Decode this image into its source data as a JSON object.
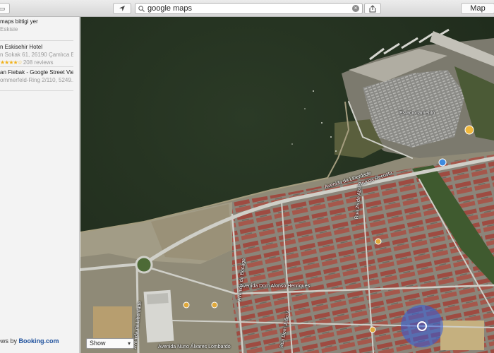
{
  "toolbar": {
    "search_value": "google maps",
    "map_button": "Map"
  },
  "sidebar": {
    "results": [
      {
        "title": "maps bittigi yer",
        "subtitle": "Eskisie"
      },
      {
        "title": "n Eskisehir Hotel",
        "subtitle": "n Sokak 61, 26190 Çamlıca E...",
        "reviews": "208 reviews",
        "stars": 4
      },
      {
        "title": "an Fiebak - Google Street Vie...",
        "subtitle": "ommerfeld-Ring 2/110, 5249..."
      }
    ],
    "attribution_prefix": "ews by",
    "attribution_brand": "Booking.com"
  },
  "map": {
    "street_labels": {
      "avenida_da_liberdade": "Avenida da Liberdade",
      "rua_da_recosta": "Rua da Recosta",
      "rua_25_de_abril": "Rua 25 de Abril",
      "avenida_do_bocage": "Avenida do Bocage",
      "avenida_dom_afonso": "Avenida Dom Afonso Henriques",
      "avenida_da_liberdade_2": "Avenida da Liberdade",
      "rua_dom_joao_v": "Rua Dom João V",
      "avenida_nuno_lombardo": "Avenida Nuno Álvares Lombardo",
      "estacionamento": "Estacionamento"
    },
    "show_select": "Show",
    "colors": {
      "water": "#233020",
      "land": "#8f8a77",
      "roof": "#9c4a40",
      "road": "#c9c9c2"
    }
  }
}
